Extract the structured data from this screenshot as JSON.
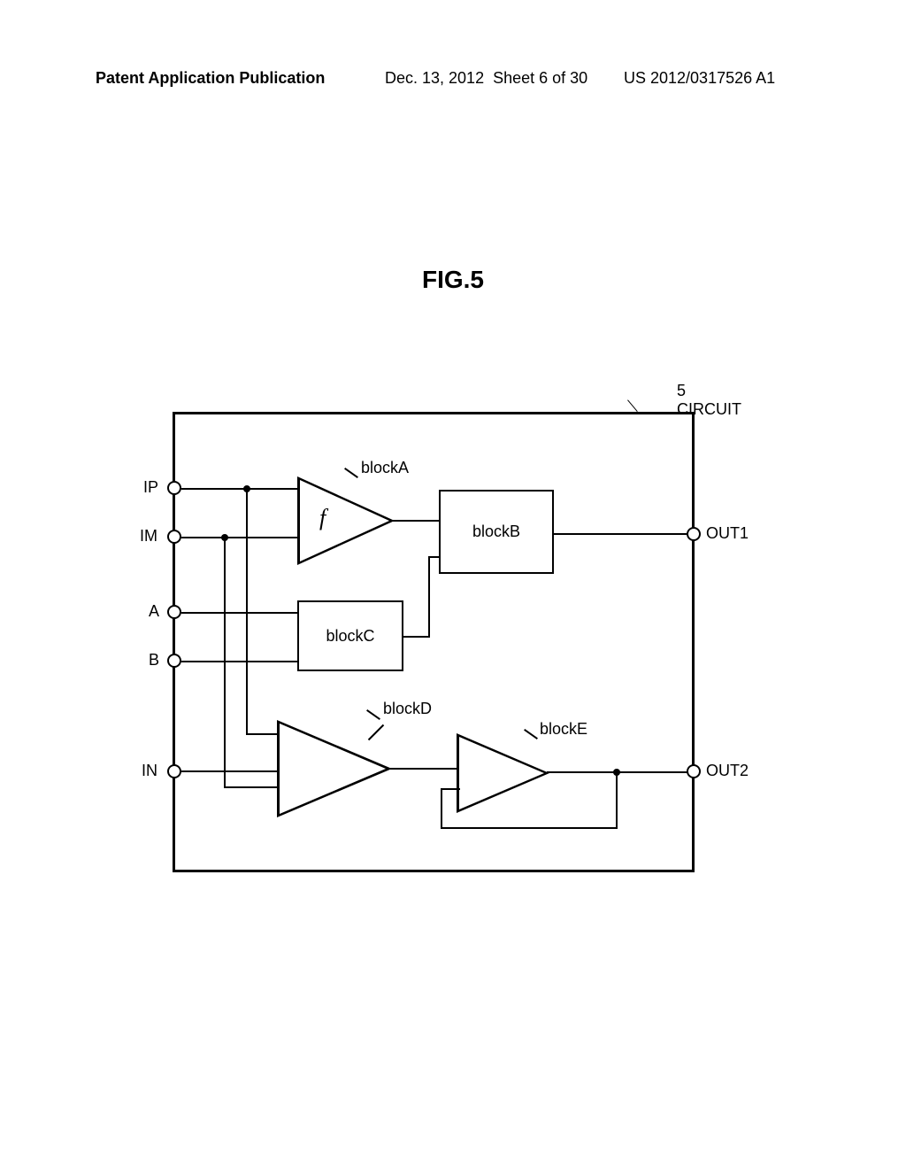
{
  "header": {
    "left": "Patent Application Publication",
    "date": "Dec. 13, 2012",
    "sheet": "Sheet 6 of 30",
    "pubno": "US 2012/0317526 A1"
  },
  "figure": {
    "title": "FIG.5",
    "ref_num": "5",
    "ref_label": "CIRCUIT"
  },
  "terminals": {
    "ip": "IP",
    "im": "IM",
    "a": "A",
    "b": "B",
    "in": "IN",
    "out1": "OUT1",
    "out2": "OUT2"
  },
  "blocks": {
    "a": "blockA",
    "b": "blockB",
    "c": "blockC",
    "d": "blockD",
    "e": "blockE"
  },
  "func": "f"
}
